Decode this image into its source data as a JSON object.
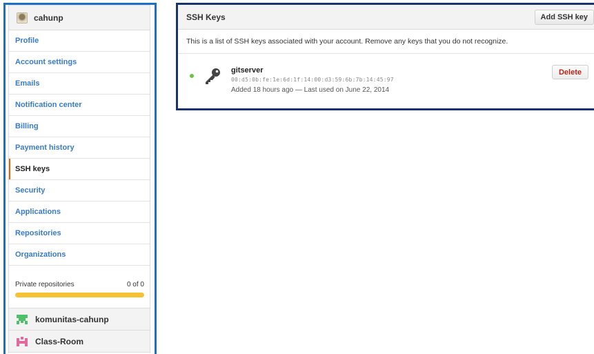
{
  "sidebar": {
    "account": {
      "name": "cahunp",
      "avatar_icon": "user-avatar"
    },
    "items": [
      {
        "label": "Profile",
        "selected": false
      },
      {
        "label": "Account settings",
        "selected": false
      },
      {
        "label": "Emails",
        "selected": false
      },
      {
        "label": "Notification center",
        "selected": false
      },
      {
        "label": "Billing",
        "selected": false
      },
      {
        "label": "Payment history",
        "selected": false
      },
      {
        "label": "SSH keys",
        "selected": true
      },
      {
        "label": "Security",
        "selected": false
      },
      {
        "label": "Applications",
        "selected": false
      },
      {
        "label": "Repositories",
        "selected": false
      },
      {
        "label": "Organizations",
        "selected": false
      }
    ],
    "private_repos": {
      "label": "Private repositories",
      "count": "0 of 0",
      "fill_fraction": 1.0,
      "bar_color": "#f4c233"
    },
    "organizations": [
      {
        "name": "komunitas-cahunp",
        "icon": "org-identicon-icon",
        "color": "#4fbf6b"
      },
      {
        "name": "Class-Room",
        "icon": "org-identicon-icon",
        "color": "#e06b9c"
      }
    ]
  },
  "ssh_panel": {
    "title": "SSH Keys",
    "add_button": "Add SSH key",
    "description": "This is a list of SSH keys associated with your account. Remove any keys that you do not recognize.",
    "keys": [
      {
        "title": "gitserver",
        "fingerprint": "00:d5:0b:fe:1e:6d:1f:14:00:d3:59:6b:7b:14:45:97",
        "meta": "Added 18 hours ago — Last used on June 22, 2014",
        "status_color": "#6cc644",
        "icon": "key-icon",
        "delete_label": "Delete"
      }
    ]
  },
  "colors": {
    "accent_blue": "#1f6fc4",
    "link": "#3a7bc8",
    "selected_marker": "#d26911",
    "danger": "#b0281a"
  }
}
